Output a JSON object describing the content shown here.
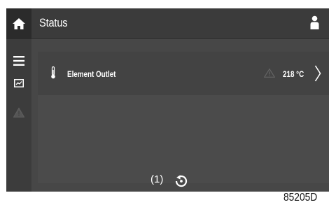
{
  "header": {
    "title": "Status",
    "home_icon": "home-icon",
    "user_icon": "user-icon"
  },
  "sidebar": {
    "items": [
      {
        "icon": "menu-icon",
        "active": true
      },
      {
        "icon": "chart-icon",
        "active": true
      },
      {
        "icon": "warning-icon",
        "active": false
      }
    ]
  },
  "status_list": {
    "rows": [
      {
        "icon": "thermometer-icon",
        "label": "Element Outlet",
        "warning_icon": "warning-icon",
        "value": "218 °C",
        "action_icon": "chevron-right-icon"
      }
    ]
  },
  "annotation": {
    "callout": "(1)",
    "icon": "refresh-icon"
  },
  "figure_id": "85205D",
  "colors": {
    "background": "#474747",
    "header": "#3b3b3b",
    "sidebar": "#3c3c3c",
    "text": "#ffffff"
  }
}
